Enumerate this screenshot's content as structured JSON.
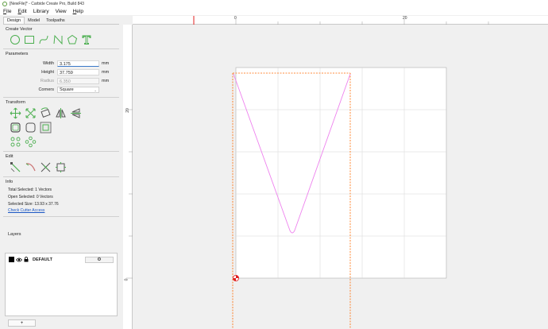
{
  "window": {
    "title": "[NewFile]* - Carbide Create Pro, Build 843"
  },
  "menu": [
    {
      "key": "F",
      "rest": "ile"
    },
    {
      "key": "E",
      "rest": "dit"
    },
    {
      "key": "",
      "rest": "Library"
    },
    {
      "key": "",
      "rest": "View"
    },
    {
      "key": "H",
      "rest": "elp"
    }
  ],
  "tabs": [
    "Design",
    "Model",
    "Toolpaths"
  ],
  "create_vector": {
    "title": "Create Vector",
    "icons": [
      "circle-icon",
      "rectangle-icon",
      "curve-icon",
      "polyline-icon",
      "polygon-icon",
      "text-icon"
    ]
  },
  "parameters": {
    "title": "Parameters",
    "width_label": "Width",
    "width_value": "3.175",
    "width_unit": "mm",
    "height_label": "Height",
    "height_value": "37.759",
    "height_unit": "mm",
    "radius_label": "Radius",
    "radius_value": "6.350",
    "radius_unit": "mm",
    "corners_label": "Corners",
    "corners_value": "Square"
  },
  "transform": {
    "title": "Transform",
    "row1": [
      "move-icon",
      "scale-icon",
      "rotate-icon",
      "mirror-icon",
      "flip-icon"
    ],
    "row2": [
      "offset-icon",
      "round-corner-icon",
      "align-box-icon"
    ],
    "row3": [
      "circle-pattern-icon",
      "linear-pattern-icon"
    ]
  },
  "edit": {
    "title": "Edit",
    "icons": [
      "node-edit-icon",
      "knife-icon",
      "trim-icon",
      "boundary-icon"
    ]
  },
  "info": {
    "title": "Info",
    "total_selected": "Total Selected:   1 Vectors",
    "open_selected": "Open Selected:   0 Vectors",
    "selected_size": "Selected Size:    13.93 x 37.76",
    "cutter_link": "Check Cutter Access"
  },
  "layers": {
    "title": "Layers",
    "items": [
      {
        "name": "DEFAULT",
        "color": "#000000"
      }
    ],
    "add_label": "+"
  },
  "ruler": {
    "top_labels": [
      "0",
      "20"
    ],
    "left_labels": [
      "20",
      "0"
    ]
  },
  "colors": {
    "vector": "#ee82ee",
    "selection": "#ff6a00",
    "grid": "#cfcfcf",
    "stock": "#ffffff",
    "accent_green": "#4caf50"
  }
}
